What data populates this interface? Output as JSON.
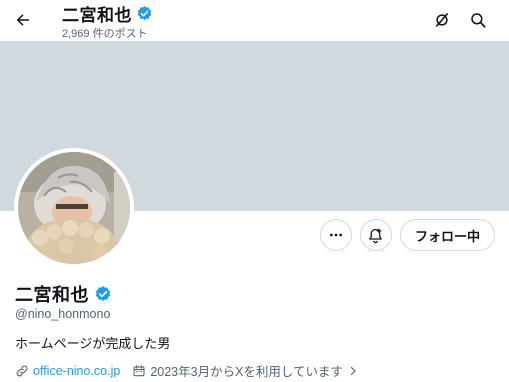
{
  "header": {
    "title": "二宮和也",
    "post_count": "2,969 件のポスト",
    "icons": [
      "back-arrow-icon",
      "verified-badge-icon",
      "grok-icon",
      "search-icon"
    ]
  },
  "profile": {
    "name": "二宮和也",
    "handle": "@nino_honmono",
    "bio": "ホームページが完成した男",
    "website": "office-nino.co.jp",
    "joined": "2023年3月からXを利用しています"
  },
  "actions": {
    "follow_label": "フォロー中",
    "icons": [
      "more-icon",
      "notify-bell-icon"
    ]
  },
  "colors": {
    "banner": "#cfd9de",
    "accent": "#1d9bf0",
    "secondary_text": "#536471"
  }
}
